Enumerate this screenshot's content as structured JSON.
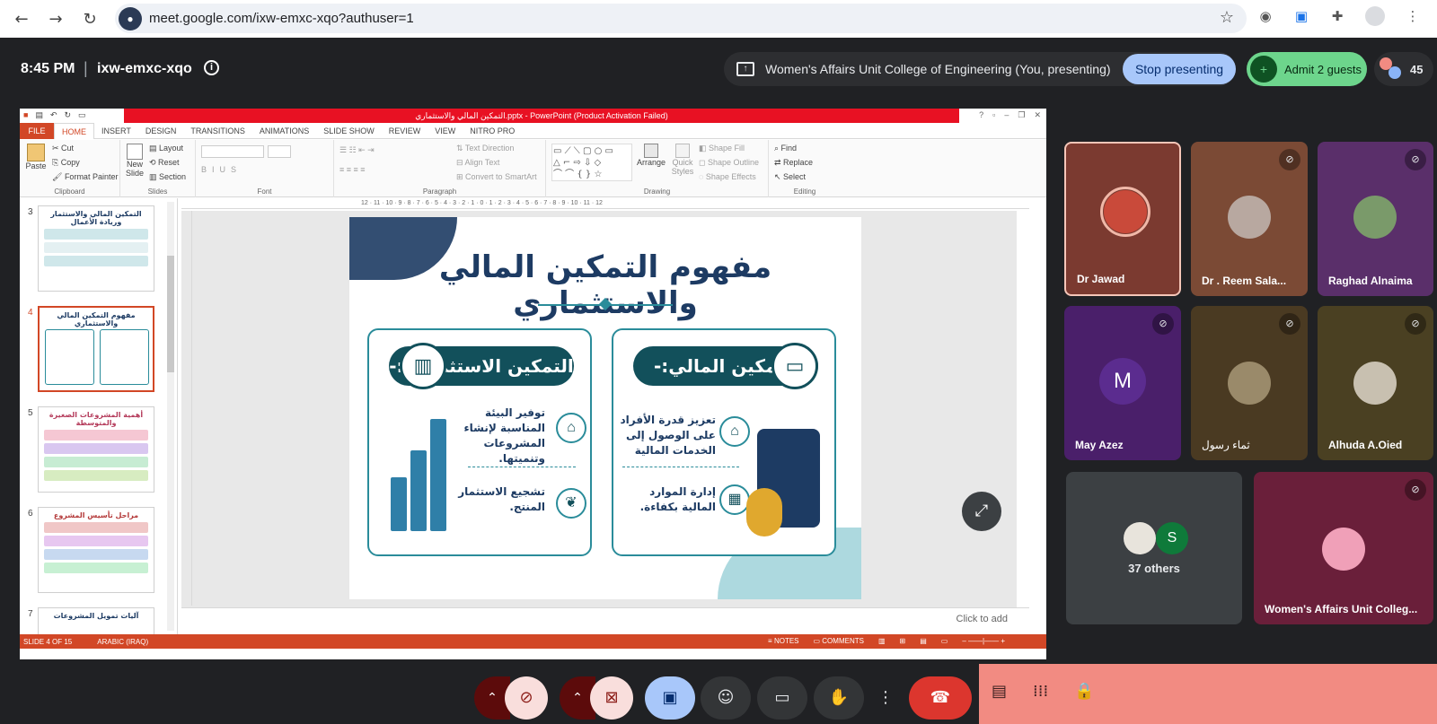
{
  "browser": {
    "url": "meet.google.com/ixw-emxc-xqo?authuser=1",
    "back_icon": "arrow-left-icon",
    "forward_icon": "arrow-right-icon",
    "reload_icon": "reload-icon"
  },
  "meet": {
    "time": "8:45 PM",
    "separator": "|",
    "meeting_code": "ixw-emxc-xqo",
    "presenting_text": "Women's Affairs Unit College of Engineering (You, presenting)",
    "stop_presenting": "Stop presenting",
    "admit_label": "Admit 2 guests",
    "people_count": "45"
  },
  "ppt": {
    "window_title": "التمكين المالي والاستثماري.pptx - PowerPoint (Product Activation Failed)",
    "tabs": [
      "FILE",
      "HOME",
      "INSERT",
      "DESIGN",
      "TRANSITIONS",
      "ANIMATIONS",
      "SLIDE SHOW",
      "REVIEW",
      "VIEW",
      "NITRO PRO"
    ],
    "active_tab": "HOME",
    "ribbon": {
      "clipboard": {
        "label": "Clipboard",
        "paste": "Paste",
        "cut": "Cut",
        "copy": "Copy",
        "format_painter": "Format Painter"
      },
      "slides": {
        "label": "Slides",
        "new_slide": "New Slide",
        "layout": "Layout",
        "reset": "Reset",
        "section": "Section"
      },
      "font": {
        "label": "Font"
      },
      "paragraph": {
        "label": "Paragraph",
        "text_direction": "Text Direction",
        "align_text": "Align Text",
        "convert": "Convert to SmartArt"
      },
      "drawing": {
        "label": "Drawing",
        "arrange": "Arrange",
        "quick_styles": "Quick Styles",
        "shape_fill": "Shape Fill",
        "shape_outline": "Shape Outline",
        "shape_effects": "Shape Effects"
      },
      "editing": {
        "label": "Editing",
        "find": "Find",
        "replace": "Replace",
        "select": "Select"
      }
    },
    "ruler_ticks": "12 · 11 · 10 · 9 · 8 · 7 · 6 · 5 · 4 · 3 · 2 · 1 · 0 · 1 · 2 · 3 · 4 · 5 · 6 · 7 · 8 · 9 · 10 · 11 · 12",
    "thumbnails": [
      {
        "num": "3",
        "title": "التمكين المالي والاستثمار وريادة الأعمال"
      },
      {
        "num": "4",
        "title": "مفهوم التمكين المالي والاستثماري"
      },
      {
        "num": "5",
        "title": "أهمية المشروعات الصغيرة والمتوسطة"
      },
      {
        "num": "6",
        "title": "مراحل تأسيس المشروع"
      },
      {
        "num": "7",
        "title": "آليات تمويل المشروعات"
      }
    ],
    "slide": {
      "title": "مفهوم التمكين المالي والاستثماري",
      "right_card": {
        "heading": "التمكين المالي:-",
        "item1": "تعزيز قدرة الأفراد على الوصول إلى الخدمات المالية",
        "item2": "إدارة الموارد المالية بكفاءة."
      },
      "left_card": {
        "heading": "التمكين الاستثماري:-",
        "item1": "توفير البيئة المناسبة لإنشاء المشروعات وتنميتها.",
        "item2": "تشجيع الاستثمار المنتج."
      }
    },
    "notes_placeholder": "Click to add",
    "status": {
      "slide": "SLIDE 4 OF 15",
      "language": "ARABIC (IRAQ)",
      "notes": "NOTES",
      "comments": "COMMENTS"
    }
  },
  "participants": [
    {
      "name": "Dr Jawad",
      "muted": false
    },
    {
      "name": "Dr . Reem Sala...",
      "muted": true
    },
    {
      "name": "Raghad Alnaima",
      "muted": true
    },
    {
      "name": "May Azez",
      "muted": true,
      "letter": "M"
    },
    {
      "name": "ثماء رسول",
      "muted": true
    },
    {
      "name": "Alhuda A.Oied",
      "muted": true
    },
    {
      "name": "Women's Affairs Unit Colleg...",
      "muted": true
    }
  ],
  "others": {
    "label": "37 others",
    "letter": "S"
  },
  "colors": {
    "meet_bg": "#202124",
    "accent_blue": "#a8c7fa",
    "admit_green": "#6dd58c",
    "end_call_red": "#dc362e",
    "ppt_orange": "#d24726",
    "slide_navy": "#1d3b63",
    "slide_teal": "#2a8c9a"
  }
}
